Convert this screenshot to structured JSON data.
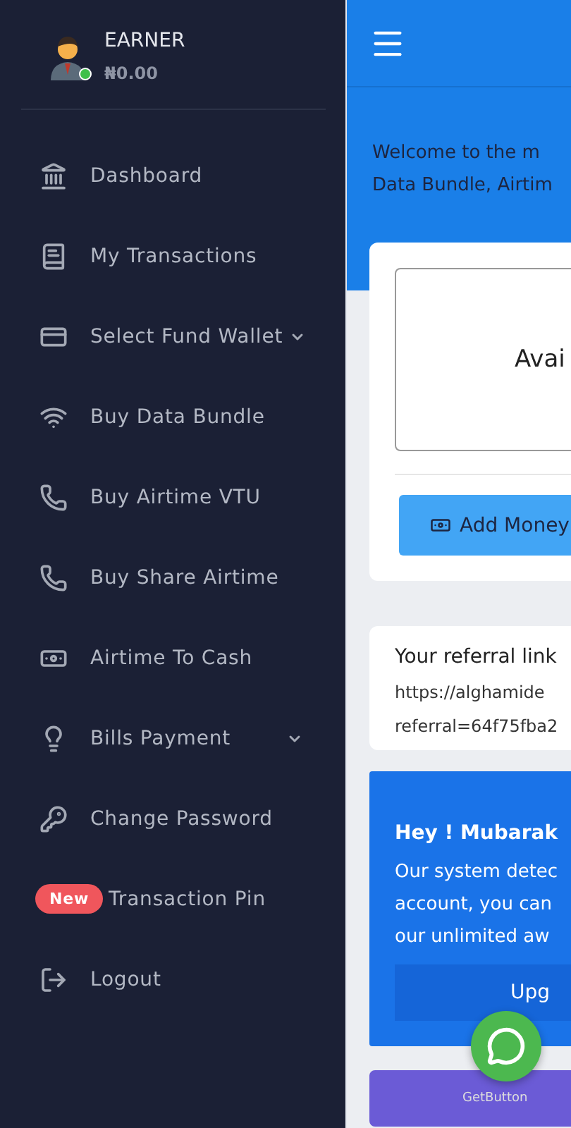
{
  "user": {
    "name": "EARNER",
    "balance": "₦0.00",
    "online": true
  },
  "menu": [
    {
      "kind": "link",
      "label": "Dashboard"
    },
    {
      "kind": "link",
      "label": "My Transactions"
    },
    {
      "kind": "dropdown",
      "label": "Select Fund Wallet"
    },
    {
      "kind": "link",
      "label": "Buy Data Bundle"
    },
    {
      "kind": "link",
      "label": "Buy Airtime VTU"
    },
    {
      "kind": "link",
      "label": "Buy Share Airtime"
    },
    {
      "kind": "link",
      "label": "Airtime To Cash"
    },
    {
      "kind": "dropdown",
      "label": "Bills Payment"
    },
    {
      "kind": "link",
      "label": "Change Password"
    },
    {
      "kind": "badge",
      "badge": "New",
      "label": "Transaction Pin"
    },
    {
      "kind": "link",
      "label": "Logout"
    }
  ],
  "welcome": [
    "Welcome to the m",
    "Data Bundle, Airtim"
  ],
  "wallet": {
    "label": "Avai",
    "button": "Add Money"
  },
  "referral": {
    "title": "Your referral link",
    "lines": [
      "https://alghamide",
      "referral=64f75fba2"
    ]
  },
  "promo": {
    "title": "Hey ! Mubarak",
    "lines": [
      "Our system detec",
      "account, you can",
      "our unlimited aw"
    ],
    "button": "Upg"
  },
  "chat_widget": {
    "credit": "GetButton"
  }
}
